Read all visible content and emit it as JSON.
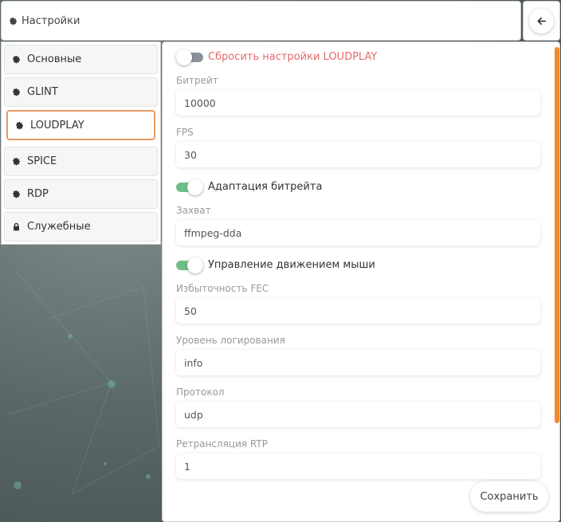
{
  "header": {
    "title": "Настройки",
    "icon": "gear-icon"
  },
  "back_button": {
    "icon": "arrow-left-icon"
  },
  "sidebar": {
    "items": [
      {
        "label": "Основные",
        "icon": "gear-icon"
      },
      {
        "label": "GLINT",
        "icon": "gear-icon"
      },
      {
        "label": "LOUDPLAY",
        "icon": "gear-icon",
        "active": true
      },
      {
        "label": "SPICE",
        "icon": "gear-icon"
      },
      {
        "label": "RDP",
        "icon": "gear-icon"
      },
      {
        "label": "Служебные",
        "icon": "lock-icon"
      }
    ]
  },
  "settings": {
    "reset_toggle": {
      "label": "Сбросить настройки LOUDPLAY",
      "on": false
    },
    "bitrate": {
      "label": "Битрейт",
      "value": "10000"
    },
    "fps": {
      "label": "FPS",
      "value": "30"
    },
    "adaptive_bitrate": {
      "label": "Адаптация битрейта",
      "on": true
    },
    "capture": {
      "label": "Захват",
      "value": "ffmpeg-dda"
    },
    "mouse_control": {
      "label": "Управление движением мыши",
      "on": true
    },
    "fec": {
      "label": "Избыточность FEC",
      "value": "50"
    },
    "log_level": {
      "label": "Уровень логирования",
      "value": "info"
    },
    "protocol": {
      "label": "Протокол",
      "value": "udp"
    },
    "rtp": {
      "label": "Ретрансляция RTP",
      "value": "1"
    }
  },
  "save_button": {
    "label": "Сохранить"
  },
  "colors": {
    "accent": "#f08a2c",
    "active_border": "#e89a62",
    "reset_text": "#e46a6a",
    "toggle_on": "#6fbf8a",
    "toggle_off": "#8a9198"
  }
}
